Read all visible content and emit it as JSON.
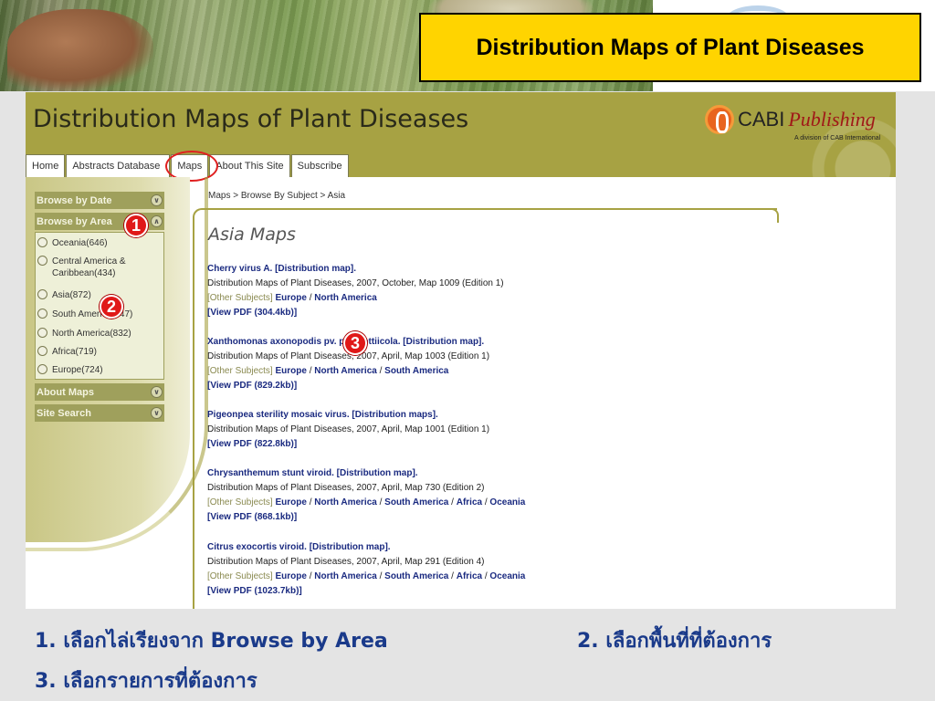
{
  "slide": {
    "title": "Distribution Maps of Plant Diseases",
    "captions": [
      "1. เลือกไล่เรียงจาก Browse by Area",
      "2. เลือกพื้นที่ที่ต้องการ",
      "3. เลือกรายการที่ต้องการ"
    ],
    "callouts": [
      "1",
      "2",
      "3"
    ]
  },
  "site": {
    "title": "Distribution Maps of Plant Diseases",
    "brand_name": "CABI",
    "brand_publishing": "Publishing",
    "brand_sub": "A division of CAB International",
    "nav": [
      "Home",
      "Abstracts Database",
      "Maps",
      "About This Site",
      "Subscribe"
    ]
  },
  "sidebar": {
    "browse_by_date": "Browse by Date",
    "browse_by_area": "Browse by Area",
    "areas": [
      "Oceania(646)",
      "Central America & Caribbean(434)",
      "Asia(872)",
      "South America(447)",
      "North America(832)",
      "Africa(719)",
      "Europe(724)"
    ],
    "about_maps": "About Maps",
    "site_search": "Site Search"
  },
  "content": {
    "breadcrumb": "Maps > Browse By Subject > Asia",
    "heading": "Asia Maps",
    "other_label": "[Other Subjects]",
    "records": [
      {
        "title": "Cherry virus A. [Distribution map].",
        "source": "Distribution Maps of Plant Diseases, 2007, October, Map 1009 (Edition 1)",
        "other": [
          "Europe",
          "North America"
        ],
        "pdf": "[View PDF (304.4kb)]"
      },
      {
        "title": "Xanthomonas axonopodis pv. poinsettiicola. [Distribution map].",
        "source": "Distribution Maps of Plant Diseases, 2007, April, Map 1003 (Edition 1)",
        "other": [
          "Europe",
          "North America",
          "South America"
        ],
        "pdf": "[View PDF (829.2kb)]"
      },
      {
        "title": "Pigeonpea sterility mosaic virus. [Distribution maps].",
        "source": "Distribution Maps of Plant Diseases, 2007, April, Map 1001 (Edition 1)",
        "other": [],
        "pdf": "[View PDF (822.8kb)]"
      },
      {
        "title": "Chrysanthemum stunt viroid. [Distribution map].",
        "source": "Distribution Maps of Plant Diseases, 2007, April, Map 730 (Edition 2)",
        "other": [
          "Europe",
          "North America",
          "South America",
          "Africa",
          "Oceania"
        ],
        "pdf": "[View PDF (868.1kb)]"
      },
      {
        "title": "Citrus exocortis viroid. [Distribution map].",
        "source": "Distribution Maps of Plant Diseases, 2007, April, Map 291 (Edition 4)",
        "other": [
          "Europe",
          "North America",
          "South America",
          "Africa",
          "Oceania"
        ],
        "pdf": "[View PDF (1023.7kb)]"
      }
    ]
  },
  "colors": {
    "title_box": "#ffd400",
    "site_header": "#a7a243",
    "link": "#1a2a80",
    "callout": "#e01818",
    "caption": "#1a3a8a"
  }
}
